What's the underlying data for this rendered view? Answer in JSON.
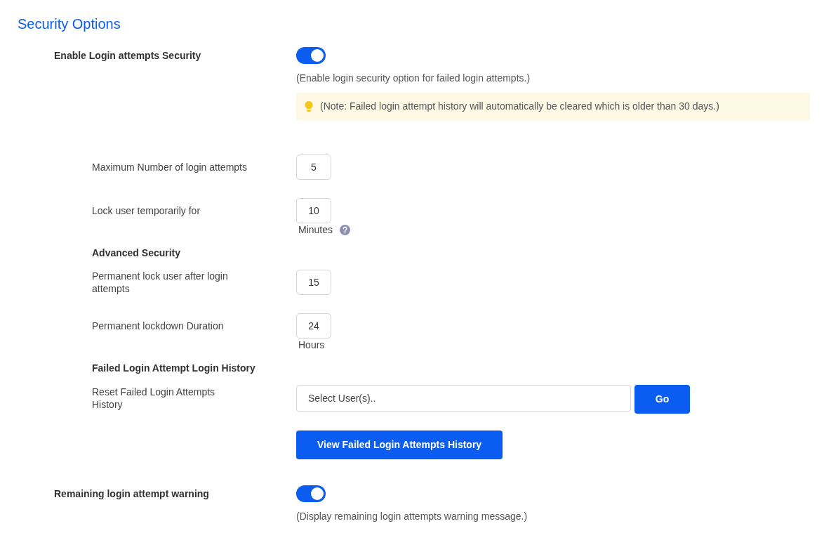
{
  "title": "Security Options",
  "login_security": {
    "label": "Enable Login attempts Security",
    "on": true,
    "description": "(Enable login security option for failed login attempts.)",
    "note": "(Note: Failed login attempt history will automatically be cleared which is older than 30 days.)"
  },
  "fields": [
    {
      "kind": "number",
      "label": "Maximum Number of login attempts",
      "value": "5"
    },
    {
      "kind": "number",
      "label": "Lock user temporarily for",
      "value": "10",
      "unit": "Minutes",
      "help": true
    },
    {
      "kind": "heading",
      "label": "Advanced Security"
    },
    {
      "kind": "number",
      "label": "Permanent lock user after login attempts",
      "value": "15"
    },
    {
      "kind": "number",
      "label": "Permanent lockdown Duration",
      "value": "24",
      "unit": "Hours",
      "help": false
    },
    {
      "kind": "heading",
      "label": "Failed Login Attempt Login History"
    },
    {
      "kind": "select",
      "label": "Reset Failed Login Attempts History",
      "placeholder": "Select User(s)..",
      "button": "Go"
    },
    {
      "kind": "button",
      "label": "View Failed Login Attempts History"
    }
  ],
  "warning": {
    "label": "Remaining login attempt warning",
    "on": true,
    "description": "(Display remaining login attempts warning message.)"
  }
}
